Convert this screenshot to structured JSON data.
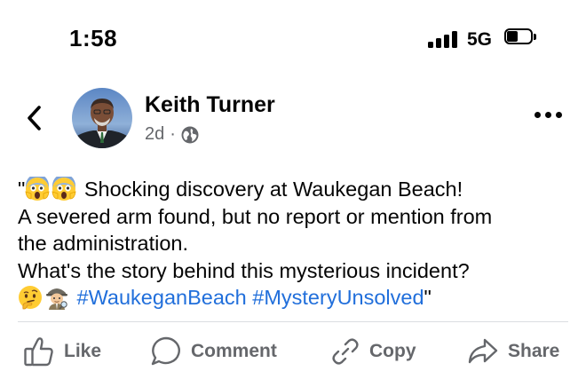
{
  "status_bar": {
    "time": "1:58",
    "network": "5G",
    "signal_icon": "cellular-signal-icon",
    "battery_icon": "battery-icon",
    "battery_level": 0.35
  },
  "header": {
    "back_icon": "chevron-left-icon",
    "author_name": "Keith Turner",
    "post_age": "2d",
    "separator": "·",
    "audience_icon": "globe-icon",
    "more_icon": "ellipsis-icon"
  },
  "post": {
    "lines": [
      {
        "prefix": "\"",
        "emojis": [
          "screaming-face-emoji",
          "screaming-face-emoji"
        ],
        "text": " Shocking discovery at Waukegan Beach!"
      },
      {
        "text": "A severed arm found, but no report or mention from"
      },
      {
        "text": "the administration."
      },
      {
        "text": "What's the story behind this mysterious incident?"
      }
    ],
    "last_line": {
      "emojis": [
        "thinking-face-emoji",
        "detective-emoji"
      ],
      "hashtags": [
        "#WaukeganBeach",
        "#MysteryUnsolved"
      ],
      "suffix": "\""
    }
  },
  "actions": [
    {
      "label": "Like",
      "icon": "thumbs-up-icon"
    },
    {
      "label": "Comment",
      "icon": "comment-bubble-icon"
    },
    {
      "label": "Copy",
      "icon": "link-icon"
    },
    {
      "label": "Share",
      "icon": "share-arrow-icon"
    }
  ],
  "colors": {
    "hashtag": "#216fdb",
    "muted_text": "#65676b",
    "text": "#050505",
    "divider": "#dadde1"
  }
}
